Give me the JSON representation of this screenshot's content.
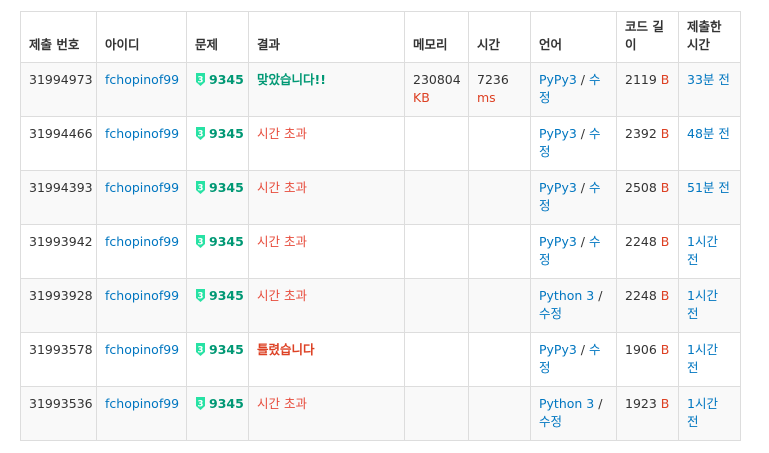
{
  "headers": {
    "submit_id": "제출 번호",
    "user": "아이디",
    "problem": "문제",
    "result": "결과",
    "memory": "메모리",
    "time": "시간",
    "language": "언어",
    "code_length": "코드 길이",
    "submitted": "제출한 시간"
  },
  "tier_color": "#27e2a4",
  "tier_digit": "3",
  "rows": [
    {
      "id": "31994973",
      "user": "fchopinof99",
      "problem": "9345",
      "result": "맞았습니다!!",
      "result_type": "ac",
      "memory": "230804",
      "memory_unit": "KB",
      "time": "7236",
      "time_unit": "ms",
      "lang": "PyPy3",
      "edit": "수정",
      "code_len": "2119",
      "code_unit": "B",
      "submitted": "33분 전"
    },
    {
      "id": "31994466",
      "user": "fchopinof99",
      "problem": "9345",
      "result": "시간 초과",
      "result_type": "tle",
      "memory": "",
      "memory_unit": "",
      "time": "",
      "time_unit": "",
      "lang": "PyPy3",
      "edit": "수정",
      "code_len": "2392",
      "code_unit": "B",
      "submitted": "48분 전"
    },
    {
      "id": "31994393",
      "user": "fchopinof99",
      "problem": "9345",
      "result": "시간 초과",
      "result_type": "tle",
      "memory": "",
      "memory_unit": "",
      "time": "",
      "time_unit": "",
      "lang": "PyPy3",
      "edit": "수정",
      "code_len": "2508",
      "code_unit": "B",
      "submitted": "51분 전"
    },
    {
      "id": "31993942",
      "user": "fchopinof99",
      "problem": "9345",
      "result": "시간 초과",
      "result_type": "tle",
      "memory": "",
      "memory_unit": "",
      "time": "",
      "time_unit": "",
      "lang": "PyPy3",
      "edit": "수정",
      "code_len": "2248",
      "code_unit": "B",
      "submitted": "1시간 전"
    },
    {
      "id": "31993928",
      "user": "fchopinof99",
      "problem": "9345",
      "result": "시간 초과",
      "result_type": "tle",
      "memory": "",
      "memory_unit": "",
      "time": "",
      "time_unit": "",
      "lang": "Python 3",
      "edit": "수정",
      "code_len": "2248",
      "code_unit": "B",
      "submitted": "1시간 전"
    },
    {
      "id": "31993578",
      "user": "fchopinof99",
      "problem": "9345",
      "result": "틀렸습니다",
      "result_type": "wa",
      "memory": "",
      "memory_unit": "",
      "time": "",
      "time_unit": "",
      "lang": "PyPy3",
      "edit": "수정",
      "code_len": "1906",
      "code_unit": "B",
      "submitted": "1시간 전"
    },
    {
      "id": "31993536",
      "user": "fchopinof99",
      "problem": "9345",
      "result": "시간 초과",
      "result_type": "tle",
      "memory": "",
      "memory_unit": "",
      "time": "",
      "time_unit": "",
      "lang": "Python 3",
      "edit": "수정",
      "code_len": "1923",
      "code_unit": "B",
      "submitted": "1시간 전"
    }
  ]
}
